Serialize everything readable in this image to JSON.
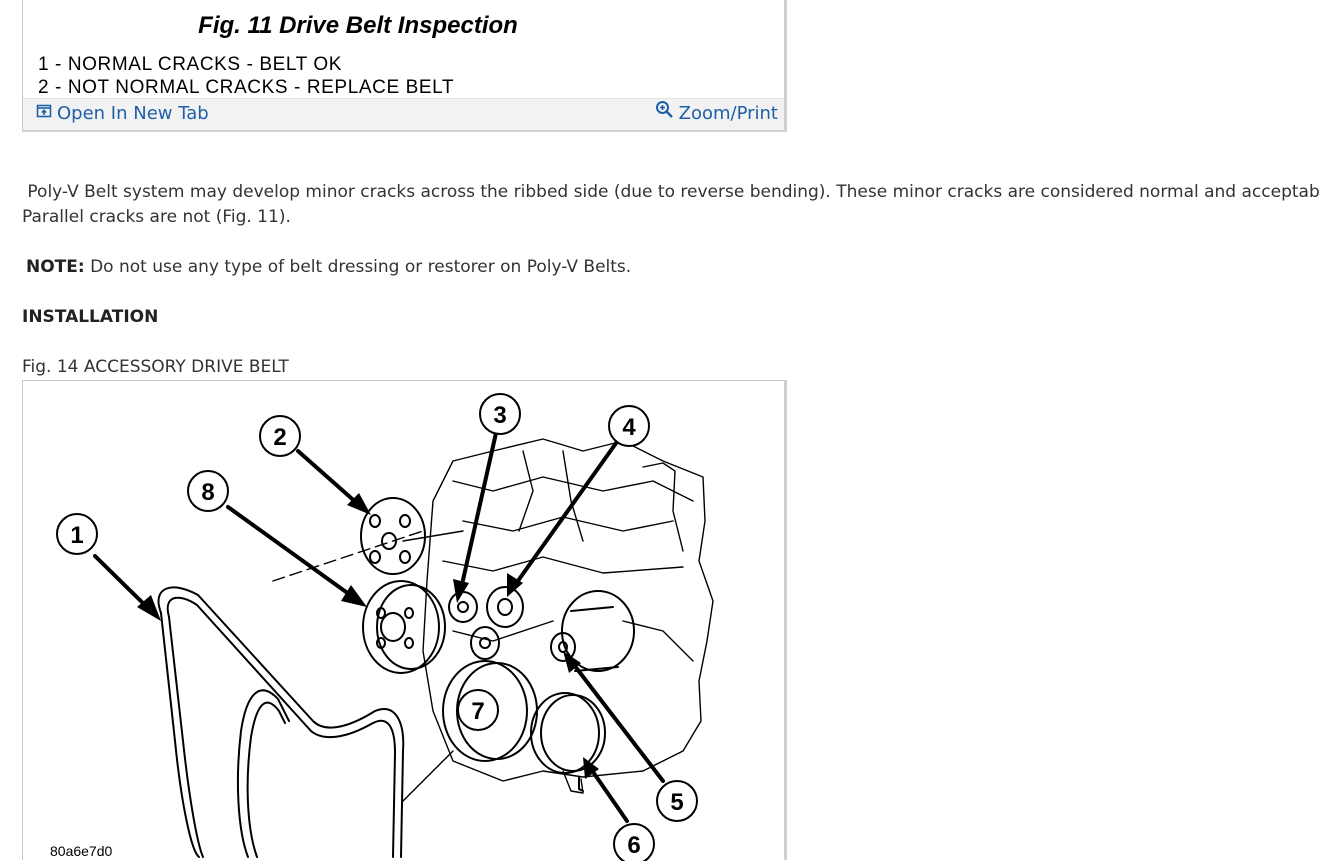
{
  "fig11": {
    "title": "Fig. 11 Drive Belt Inspection",
    "lines": [
      "1 - NORMAL CRACKS - BELT OK",
      "2 - NOT NORMAL CRACKS - REPLACE BELT"
    ],
    "open_tab_label": "Open In New Tab",
    "zoom_label": "Zoom/Print"
  },
  "body": {
    "paragraph": " Poly-V Belt system may develop minor cracks across the ribbed side (due to reverse bending). These minor cracks are considered normal and acceptable.",
    "paragraph_line2": "Parallel cracks are not (Fig. 11).",
    "note_label": "NOTE:",
    "note_text": " Do not use any type of belt dressing or restorer on Poly-V Belts.",
    "heading": "INSTALLATION",
    "fig14_caption": "Fig. 14 ACCESSORY DRIVE BELT"
  },
  "fig14": {
    "callouts": [
      "1",
      "2",
      "3",
      "4",
      "5",
      "6",
      "7",
      "8"
    ],
    "code": "80a6e7d0"
  }
}
